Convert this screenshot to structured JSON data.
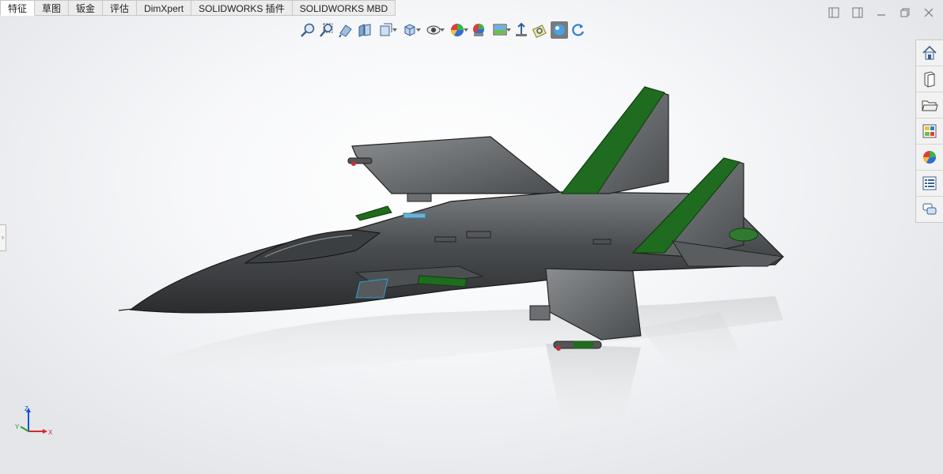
{
  "tabs": [
    {
      "label": "特征",
      "active": true
    },
    {
      "label": "草图",
      "active": false
    },
    {
      "label": "钣金",
      "active": false
    },
    {
      "label": "评估",
      "active": false
    },
    {
      "label": "DimXpert",
      "active": false
    },
    {
      "label": "SOLIDWORKS 插件",
      "active": false
    },
    {
      "label": "SOLIDWORKS MBD",
      "active": false
    }
  ],
  "heads_up_toolbar": [
    {
      "name": "zoom-to-fit-icon"
    },
    {
      "name": "zoom-to-area-icon"
    },
    {
      "name": "previous-view-icon"
    },
    {
      "name": "section-view-icon"
    },
    {
      "name": "dynamic-annotation-view-icon",
      "dropdown": true
    },
    {
      "name": "view-orientation-icon",
      "dropdown": true
    },
    {
      "name": "display-style-icon",
      "dropdown": true
    },
    {
      "name": "hide-show-items-icon",
      "dropdown": true
    },
    {
      "name": "edit-appearance-icon"
    },
    {
      "name": "apply-scene-icon",
      "dropdown": true
    },
    {
      "name": "view-setting-icon",
      "dropdown": true
    },
    {
      "name": "perspective-icon"
    },
    {
      "name": "ambient-occlusion-icon"
    },
    {
      "name": "realview-graphics-icon",
      "active": true
    },
    {
      "name": "rotate-view-icon"
    }
  ],
  "window_controls": [
    "tile-left-icon",
    "tile-right-icon",
    "minimize-icon",
    "restore-icon",
    "close-icon"
  ],
  "task_pane": [
    "home-icon",
    "design-library-icon",
    "file-explorer-icon",
    "view-palette-icon",
    "appearances-icon",
    "custom-properties-icon",
    "forum-icon"
  ],
  "colors": {
    "fuselage": "#45484a",
    "fin_tip": "#1f6b1f",
    "accent_cyan": "#2a9fd0",
    "tab_bg": "#ececec"
  },
  "triad": {
    "x": "X",
    "y": "Y",
    "z": "Z"
  },
  "left_grip": "›"
}
